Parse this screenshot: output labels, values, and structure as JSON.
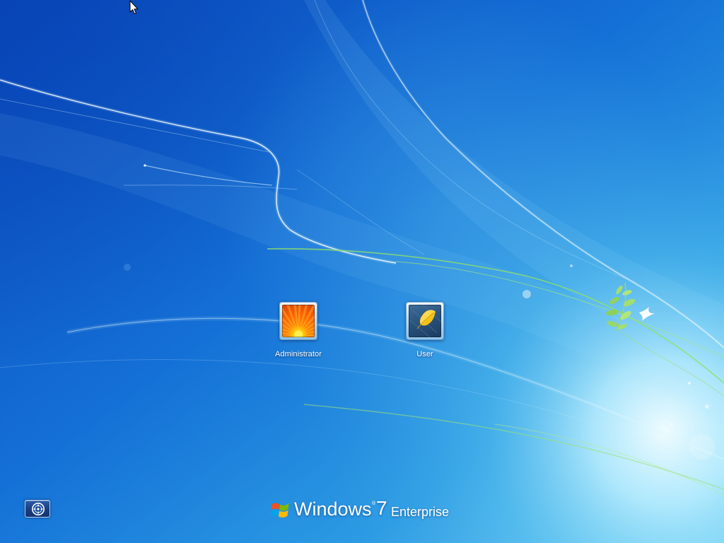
{
  "screen": {
    "type": "logon"
  },
  "users": [
    {
      "name": "Administrator",
      "picture_icon": "orange-flower-account-picture-icon"
    },
    {
      "name": "User",
      "picture_icon": "yellow-leaf-account-picture-icon"
    }
  ],
  "ease_of_access": {
    "icon": "ease-of-access-icon"
  },
  "branding": {
    "logo_icon": "windows-flag-logo-icon",
    "product": "Windows",
    "registered_mark": "®",
    "version": "7",
    "edition": "Enterprise"
  },
  "cursor": {
    "icon": "arrow-cursor-icon"
  },
  "colors": {
    "background_dark": "#0b4cc0",
    "background_mid": "#1470d6",
    "background_light": "#7fd8f6",
    "stem_green": "#8fe06a",
    "logo_red": "#f25022",
    "logo_green": "#7fba00",
    "logo_blue": "#00a4ef",
    "logo_yellow": "#ffb900"
  }
}
